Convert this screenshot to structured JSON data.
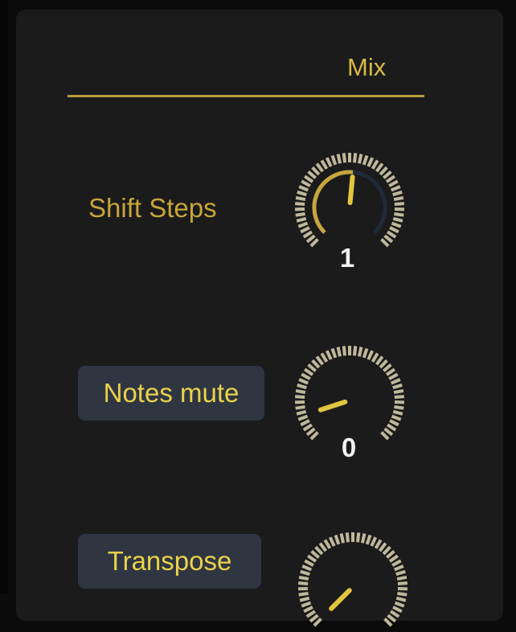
{
  "panel": {
    "title": "Mix"
  },
  "rows": [
    {
      "label": "Shift Steps",
      "value": "1",
      "style": "text",
      "fraction": 0.52
    },
    {
      "label": "Notes mute",
      "value": "0",
      "style": "button",
      "fraction": 0.1
    },
    {
      "label": "Transpose",
      "value": "",
      "style": "button",
      "fraction": 0.0
    }
  ],
  "colors": {
    "accent": "#d8b949",
    "pill_bg": "#2f3642",
    "knob_ticks": "#bfb89a",
    "knob_track": "#1f2a3a",
    "knob_arc": "#c7a640"
  }
}
